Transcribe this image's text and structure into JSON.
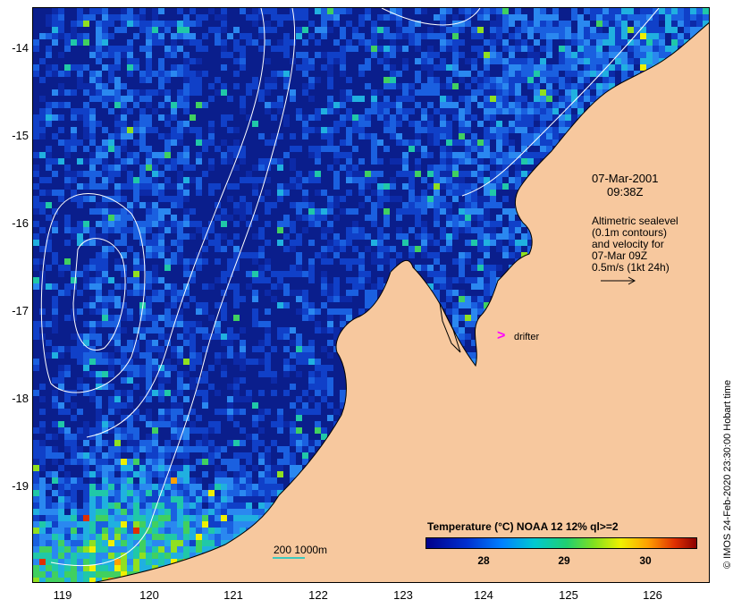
{
  "annotations": {
    "date": "07-Mar-2001",
    "time": "09:38Z",
    "legend_lines": [
      "Altimetric sealevel",
      "(0.1m contours)",
      "and velocity for",
      "07-Mar 09Z",
      "0.5m/s (1kt 24h)"
    ],
    "drifter_marker": ">",
    "drifter_label": "drifter",
    "bathymetry_scale": "200  1000m"
  },
  "colorbar": {
    "title": "Temperature (°C) NOAA 12 12% ql>=2",
    "ticks": [
      "28",
      "29",
      "30"
    ]
  },
  "axes": {
    "y_labels": [
      "-14",
      "-15",
      "-16",
      "-17",
      "-18",
      "-19"
    ],
    "x_labels": [
      "119",
      "120",
      "121",
      "122",
      "123",
      "124",
      "125",
      "126"
    ]
  },
  "credit": "© IMOS 24-Feb-2020 23:30:00 Hobart time",
  "colors": {
    "land": "#f7c89e",
    "ocean_dark": "#0a1e8c",
    "contour": "#ffffff",
    "drifter": "#ff00ff",
    "bathymetry": "#00c8c8"
  }
}
